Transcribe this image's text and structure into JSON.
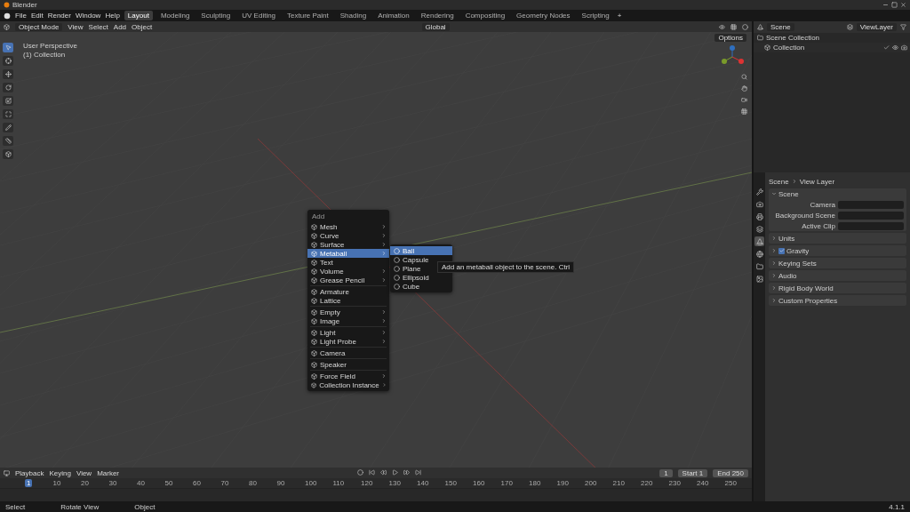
{
  "window": {
    "title": "Blender"
  },
  "menubar": {
    "menus": [
      "File",
      "Edit",
      "Render",
      "Window",
      "Help"
    ]
  },
  "workspaces": [
    {
      "label": "Layout",
      "selected": true
    },
    {
      "label": "Modeling",
      "selected": false
    },
    {
      "label": "Sculpting",
      "selected": false
    },
    {
      "label": "UV Editing",
      "selected": false
    },
    {
      "label": "Texture Paint",
      "selected": false
    },
    {
      "label": "Shading",
      "selected": false
    },
    {
      "label": "Animation",
      "selected": false
    },
    {
      "label": "Rendering",
      "selected": false
    },
    {
      "label": "Compositing",
      "selected": false
    },
    {
      "label": "Geometry Nodes",
      "selected": false
    },
    {
      "label": "Scripting",
      "selected": false
    }
  ],
  "add_workspace": "+",
  "header": {
    "mode": "Object Mode",
    "menus": [
      "View",
      "Select",
      "Add",
      "Object"
    ],
    "orientation": "Global",
    "options": "Options"
  },
  "viewport": {
    "view_name": "User Perspective",
    "collection_label": "(1) Collection"
  },
  "add_menu": {
    "title": "Add",
    "groups": [
      {
        "items": [
          {
            "label": "Mesh",
            "submenu": true,
            "selected": false
          },
          {
            "label": "Curve",
            "submenu": true,
            "selected": false
          },
          {
            "label": "Surface",
            "submenu": true,
            "selected": false
          },
          {
            "label": "Metaball",
            "submenu": true,
            "selected": true
          },
          {
            "label": "Text",
            "submenu": false,
            "selected": false
          },
          {
            "label": "Volume",
            "submenu": true,
            "selected": false
          },
          {
            "label": "Grease Pencil",
            "submenu": true,
            "selected": false
          }
        ]
      },
      {
        "items": [
          {
            "label": "Armature",
            "submenu": false,
            "selected": false
          },
          {
            "label": "Lattice",
            "submenu": false,
            "selected": false
          }
        ]
      },
      {
        "items": [
          {
            "label": "Empty",
            "submenu": true,
            "selected": false
          },
          {
            "label": "Image",
            "submenu": true,
            "selected": false
          }
        ]
      },
      {
        "items": [
          {
            "label": "Light",
            "submenu": true,
            "selected": false
          },
          {
            "label": "Light Probe",
            "submenu": true,
            "selected": false
          }
        ]
      },
      {
        "items": [
          {
            "label": "Camera",
            "submenu": false,
            "selected": false
          }
        ]
      },
      {
        "items": [
          {
            "label": "Speaker",
            "submenu": false,
            "selected": false
          }
        ]
      },
      {
        "items": [
          {
            "label": "Force Field",
            "submenu": true,
            "selected": false
          },
          {
            "label": "Collection Instance",
            "submenu": true,
            "selected": false
          }
        ]
      }
    ]
  },
  "metaball_menu": {
    "items": [
      {
        "label": "Ball",
        "selected": true
      },
      {
        "label": "Capsule",
        "selected": false
      },
      {
        "label": "Plane",
        "selected": false
      },
      {
        "label": "Ellipsoid",
        "selected": false
      },
      {
        "label": "Cube",
        "selected": false
      }
    ]
  },
  "tooltip": "Add an metaball object to the scene.  Ctrl",
  "outliner": {
    "scene": "Scene",
    "view_layer": "ViewLayer",
    "items": [
      {
        "label": "Scene Collection",
        "children": [
          {
            "label": "Collection"
          }
        ]
      }
    ]
  },
  "properties": {
    "tabs": [
      {
        "kind": "tool",
        "selected": false
      },
      {
        "kind": "render",
        "selected": false
      },
      {
        "kind": "output",
        "selected": false
      },
      {
        "kind": "view_layer",
        "selected": false
      },
      {
        "kind": "scene",
        "selected": true
      },
      {
        "kind": "world",
        "selected": false
      },
      {
        "kind": "collection",
        "selected": false
      },
      {
        "kind": "texture",
        "selected": false
      }
    ],
    "breadcrumb": [
      "Scene",
      "View Layer"
    ],
    "panels": [
      {
        "label": "Scene",
        "expanded": true,
        "fields": [
          {
            "label": "Camera"
          },
          {
            "label": "Background Scene"
          },
          {
            "label": "Active Clip"
          }
        ]
      },
      {
        "label": "Units",
        "expanded": false
      },
      {
        "label": "Gravity",
        "expanded": false,
        "checked": true
      },
      {
        "label": "Keying Sets",
        "expanded": false
      },
      {
        "label": "Audio",
        "expanded": false
      },
      {
        "label": "Rigid Body World",
        "expanded": false
      },
      {
        "label": "Custom Properties",
        "expanded": false
      }
    ]
  },
  "timeline": {
    "menus": [
      "Playback",
      "Keying",
      "View",
      "Marker"
    ],
    "current_frame": "1",
    "start_label": "Start",
    "start": "1",
    "end_label": "End",
    "end": "250",
    "ruler": [
      "1",
      "10",
      "20",
      "30",
      "40",
      "50",
      "60",
      "70",
      "80",
      "90",
      "100",
      "110",
      "120",
      "130",
      "140",
      "150",
      "160",
      "170",
      "180",
      "190",
      "200",
      "210",
      "220",
      "230",
      "240",
      "250"
    ]
  },
  "status_bar": {
    "items": [
      "Select",
      "Rotate View",
      "Object"
    ],
    "version": "4.1.1"
  }
}
